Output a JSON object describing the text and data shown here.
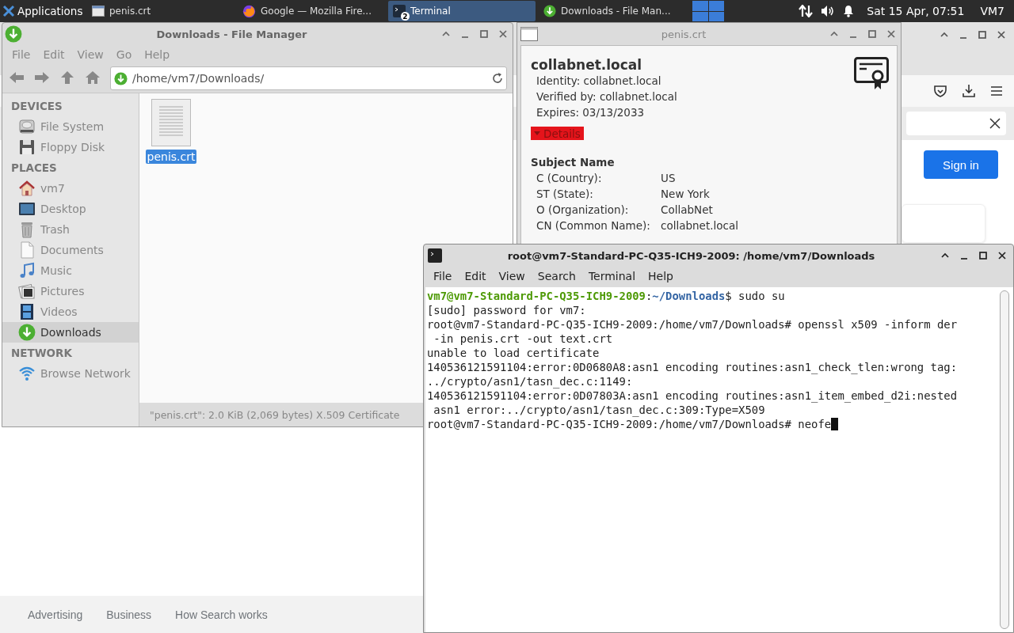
{
  "taskbar": {
    "menu_label": "Applications",
    "tasks": [
      {
        "label": "penis.crt",
        "selected": false
      },
      {
        "label": "Google — Mozilla Fire...",
        "selected": false
      },
      {
        "label": "Terminal",
        "selected": true,
        "badge": "2"
      },
      {
        "label": "Downloads - File Man...",
        "selected": false
      }
    ],
    "clock": "Sat 15 Apr, 07:51",
    "user": "VM7"
  },
  "browser": {
    "sign_in": "Sign in",
    "footer_links": [
      "Advertising",
      "Business",
      "How Search works"
    ]
  },
  "file_manager": {
    "title": "Downloads - File Manager",
    "menu": [
      "File",
      "Edit",
      "View",
      "Go",
      "Help"
    ],
    "path": "/home/vm7/Downloads/",
    "sidebar": [
      {
        "heading": "DEVICES",
        "items": [
          {
            "label": "File System",
            "selected": false
          },
          {
            "label": "Floppy Disk",
            "selected": false
          }
        ]
      },
      {
        "heading": "PLACES",
        "items": [
          {
            "label": "vm7",
            "selected": false
          },
          {
            "label": "Desktop",
            "selected": false
          },
          {
            "label": "Trash",
            "selected": false
          },
          {
            "label": "Documents",
            "selected": false
          },
          {
            "label": "Music",
            "selected": false
          },
          {
            "label": "Pictures",
            "selected": false
          },
          {
            "label": "Videos",
            "selected": false
          },
          {
            "label": "Downloads",
            "selected": true
          }
        ]
      },
      {
        "heading": "NETWORK",
        "items": [
          {
            "label": "Browse Network",
            "selected": false
          }
        ]
      }
    ],
    "files": [
      {
        "name": "penis.crt",
        "selected": true
      }
    ],
    "status": "\"penis.crt\": 2.0 KiB (2,069 bytes) X.509 Certificate"
  },
  "certificate": {
    "title": "penis.crt",
    "name": "collabnet.local",
    "fields": [
      "Identity: collabnet.local",
      "Verified by: collabnet.local",
      "Expires: 03/13/2033"
    ],
    "details_label": "Details",
    "expanded": true,
    "section": "Subject Name",
    "rows": [
      {
        "label": "C (Country):",
        "value": "US"
      },
      {
        "label": "ST (State):",
        "value": "New York"
      },
      {
        "label": "O (Organization):",
        "value": "CollabNet"
      },
      {
        "label": "CN (Common Name):",
        "value": "collabnet.local"
      }
    ]
  },
  "terminal": {
    "title": "root@vm7-Standard-PC-Q35-ICH9-2009: /home/vm7/Downloads",
    "menu": [
      "File",
      "Edit",
      "View",
      "Search",
      "Terminal",
      "Help"
    ],
    "cursor": true,
    "lines": [
      {
        "segments": [
          {
            "kind": "user",
            "text": "vm7@vm7-Standard-PC-Q35-ICH9-2009"
          },
          {
            "kind": "plain",
            "text": ":"
          },
          {
            "kind": "path",
            "text": "~/Downloads"
          },
          {
            "kind": "plain",
            "text": "$ sudo su"
          }
        ]
      },
      {
        "segments": [
          {
            "kind": "plain",
            "text": "[sudo] password for vm7:"
          }
        ]
      },
      {
        "segments": [
          {
            "kind": "plain",
            "text": "root@vm7-Standard-PC-Q35-ICH9-2009:/home/vm7/Downloads# openssl x509 -inform der"
          }
        ]
      },
      {
        "segments": [
          {
            "kind": "plain",
            "text": " -in penis.crt -out text.crt"
          }
        ]
      },
      {
        "segments": [
          {
            "kind": "plain",
            "text": "unable to load certificate"
          }
        ]
      },
      {
        "segments": [
          {
            "kind": "plain",
            "text": "140536121591104:error:0D0680A8:asn1 encoding routines:asn1_check_tlen:wrong tag:"
          }
        ]
      },
      {
        "segments": [
          {
            "kind": "plain",
            "text": "../crypto/asn1/tasn_dec.c:1149:"
          }
        ]
      },
      {
        "segments": [
          {
            "kind": "plain",
            "text": "140536121591104:error:0D07803A:asn1 encoding routines:asn1_item_embed_d2i:nested"
          }
        ]
      },
      {
        "segments": [
          {
            "kind": "plain",
            "text": " asn1 error:../crypto/asn1/tasn_dec.c:309:Type=X509"
          }
        ]
      },
      {
        "segments": [
          {
            "kind": "plain",
            "text": "root@vm7-Standard-PC-Q35-ICH9-2009:/home/vm7/Downloads# neofe"
          }
        ]
      }
    ]
  }
}
